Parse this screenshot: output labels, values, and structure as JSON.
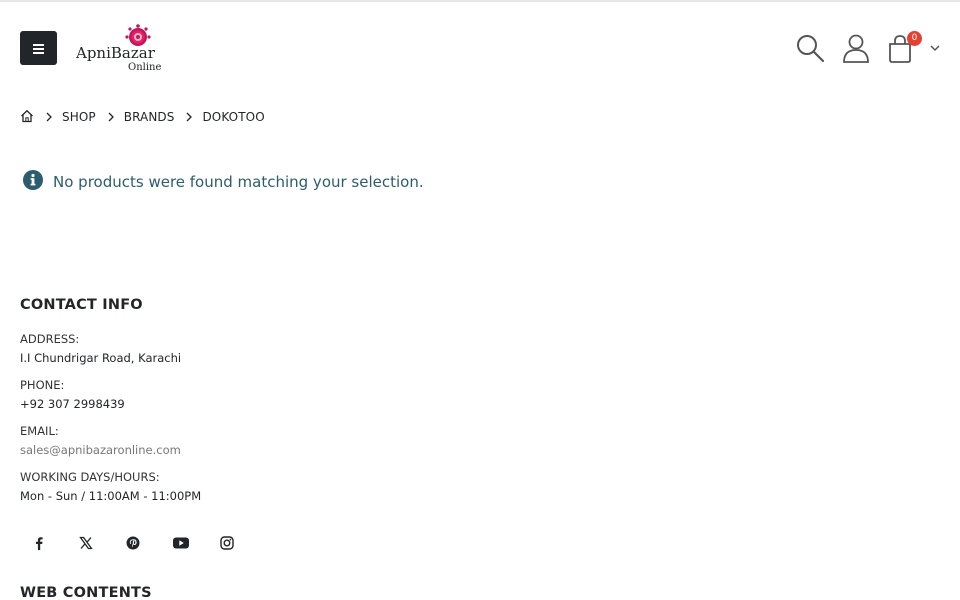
{
  "header": {
    "logo": {
      "brand_main": "ApniBazar",
      "brand_sub": "Online"
    },
    "cart": {
      "count": "0"
    }
  },
  "breadcrumb": {
    "items": [
      "SHOP",
      "BRANDS",
      "DOKOTOO"
    ]
  },
  "notice": {
    "message": "No products were found matching your selection.",
    "color": "#2c5d6f"
  },
  "footer": {
    "contact_title": "CONTACT INFO",
    "contact": [
      {
        "label": "ADDRESS:",
        "value": "I.I Chundrigar Road, Karachi"
      },
      {
        "label": "PHONE:",
        "value": "+92 307 2998439"
      },
      {
        "label": "EMAIL:",
        "value": "sales@apnibazaronline.com"
      },
      {
        "label": "WORKING DAYS/HOURS:",
        "value": "Mon - Sun / 11:00AM - 11:00PM"
      }
    ],
    "socials": [
      "facebook-icon",
      "x-twitter-icon",
      "pinterest-icon",
      "youtube-icon",
      "instagram-icon"
    ],
    "web_contents_title": "WEB CONTENTS"
  },
  "colors": {
    "dark": "#222529",
    "badge": "#e4402f",
    "info": "#2c5d6f",
    "muted": "#777777"
  }
}
